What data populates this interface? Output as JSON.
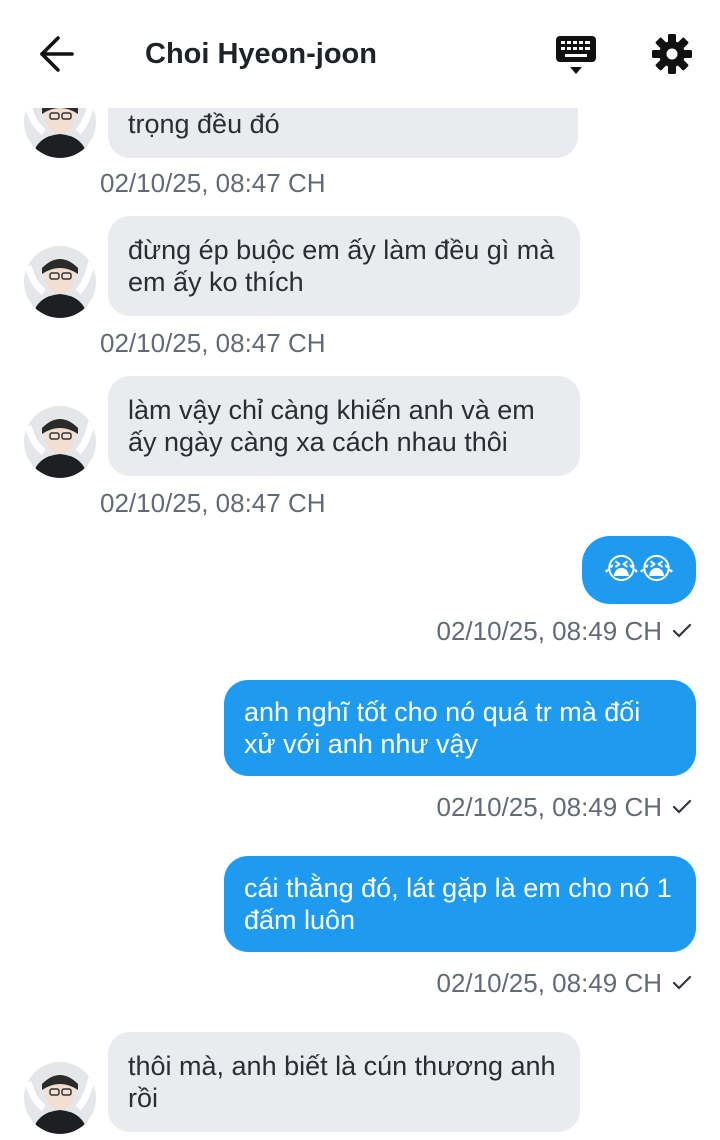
{
  "header": {
    "title": "Choi Hyeon-joon",
    "back_icon": "arrow-left-icon",
    "keyboard_icon": "keyboard-icon",
    "settings_icon": "gear-icon"
  },
  "messages": [
    {
      "dir": "in",
      "text": "trọng đều đó",
      "time": "02/10/25, 08:47 CH"
    },
    {
      "dir": "in",
      "text": "đừng ép buộc em ấy làm đều gì mà em ấy ko thích",
      "time": "02/10/25, 08:47 CH"
    },
    {
      "dir": "in",
      "text": "làm vậy chỉ càng khiến anh và em ấy ngày càng xa cách nhau thôi",
      "time": "02/10/25, 08:47 CH"
    },
    {
      "dir": "out",
      "text": "😭😭",
      "time": "02/10/25, 08:49 CH",
      "status": "sent"
    },
    {
      "dir": "out",
      "text": "anh nghĩ tốt cho nó quá tr mà đối xử với anh như vậy",
      "time": "02/10/25, 08:49 CH",
      "status": "sent"
    },
    {
      "dir": "out",
      "text": "cái thằng đó, lát gặp là em cho nó 1 đấm luôn",
      "time": "02/10/25, 08:49 CH",
      "status": "sent"
    },
    {
      "dir": "in",
      "text": "thôi mà, anh biết là cún thương anh rồi",
      "time": ""
    }
  ],
  "colors": {
    "incoming_bubble": "#e9ebee",
    "outgoing_bubble": "#1e9bf0",
    "timestamp": "#626b75"
  }
}
